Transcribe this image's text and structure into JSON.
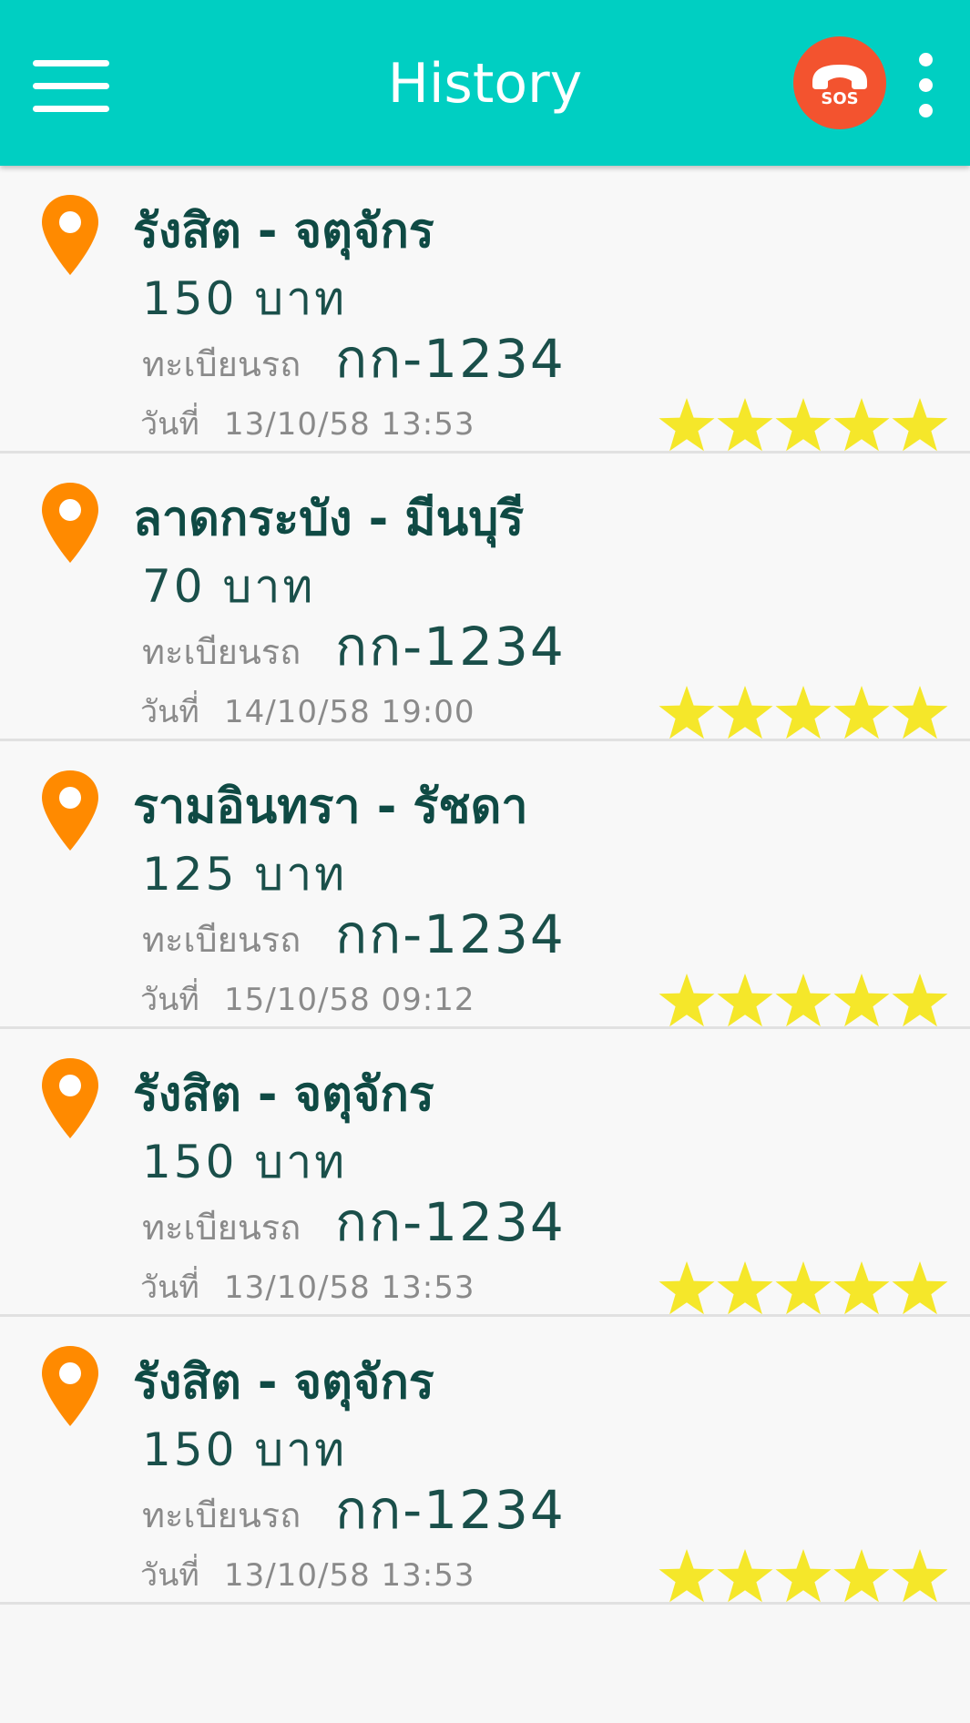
{
  "app_bar": {
    "title": "History",
    "sos_label": "SOS",
    "background_color": "#00cfc2",
    "sos_color": "#f3532f"
  },
  "history": [
    {
      "route": "รังสิต  -  จตุจักร",
      "fare": "150  บาท",
      "plate_label": "ทะเบียนรถ",
      "plate": "กก-1234",
      "date_label": "วันที่",
      "date": "13/10/58  13:53",
      "rating": 5
    },
    {
      "route": "ลาดกระบัง  -  มีนบุรี",
      "fare": "70  บาท",
      "plate_label": "ทะเบียนรถ",
      "plate": "กก-1234",
      "date_label": "วันที่",
      "date": "14/10/58  19:00",
      "rating": 5
    },
    {
      "route": "รามอินทรา  -  รัชดา",
      "fare": "125  บาท",
      "plate_label": "ทะเบียนรถ",
      "plate": "กก-1234",
      "date_label": "วันที่",
      "date": "15/10/58  09:12",
      "rating": 5
    },
    {
      "route": "รังสิต  -  จตุจักร",
      "fare": "150  บาท",
      "plate_label": "ทะเบียนรถ",
      "plate": "กก-1234",
      "date_label": "วันที่",
      "date": "13/10/58  13:53",
      "rating": 5
    },
    {
      "route": "รังสิต  -  จตุจักร",
      "fare": "150  บาท",
      "plate_label": "ทะเบียนรถ",
      "plate": "กก-1234",
      "date_label": "วันที่",
      "date": "13/10/58  13:53",
      "rating": 5
    }
  ],
  "icons": {
    "menu": "hamburger-menu-icon",
    "sos": "phone-sos-icon",
    "overflow": "more-vertical-icon",
    "location": "location-pin-icon",
    "rating": "star-icon"
  },
  "colors": {
    "pin": "#ff8a00",
    "star": "#f5e72a",
    "route_text": "#0f4a44"
  }
}
